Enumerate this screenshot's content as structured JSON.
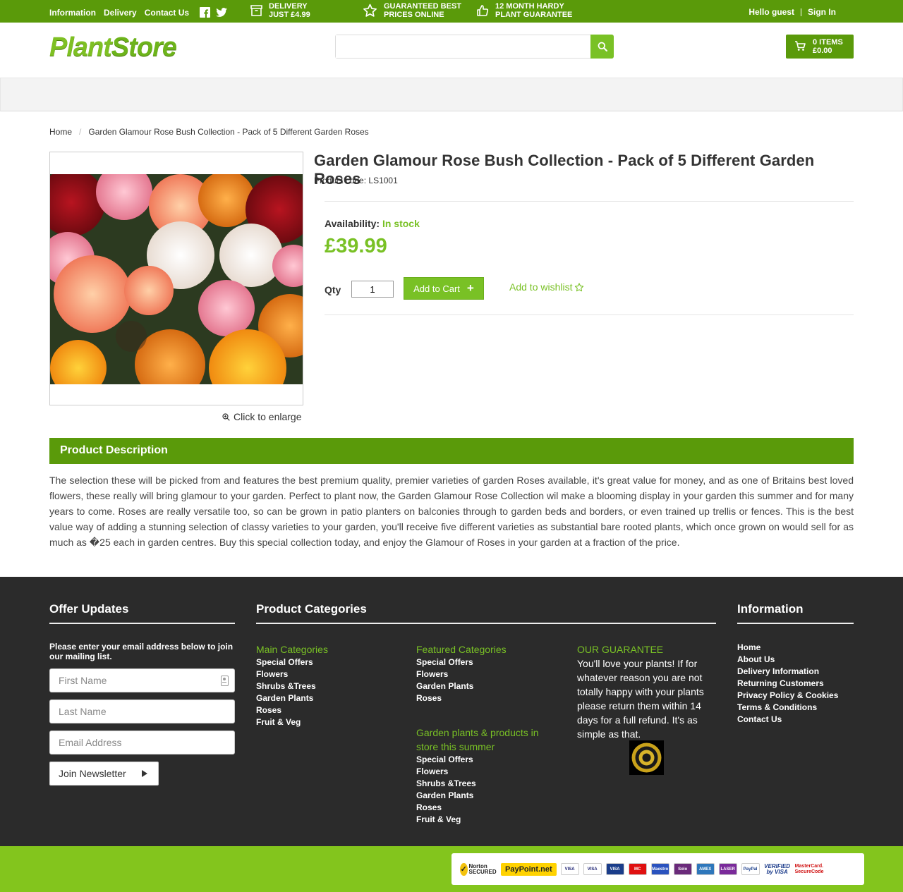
{
  "topbar": {
    "links": [
      "Information",
      "Delivery",
      "Contact Us"
    ],
    "social_icons": [
      "facebook-icon",
      "twitter-icon"
    ],
    "usps": [
      {
        "icon": "box-icon",
        "line1": "DELIVERY",
        "line2": "JUST £4.99"
      },
      {
        "icon": "star-icon",
        "line1": "GUARANTEED BEST",
        "line2": "PRICES ONLINE"
      },
      {
        "icon": "thumbs-up-icon",
        "line1": "12 MONTH HARDY",
        "line2": "PLANT GUARANTEE"
      }
    ],
    "greeting": "Hello guest",
    "signin": "Sign In"
  },
  "header": {
    "logo_part1": "Plant",
    "logo_part2": "Store",
    "search_placeholder": "",
    "cart_items": "0 ITEMS",
    "cart_total": "£0.00"
  },
  "breadcrumb": {
    "home": "Home",
    "separator": "/",
    "current": "Garden Glamour Rose Bush Collection - Pack of 5 Different Garden Roses"
  },
  "product": {
    "title": "Garden Glamour Rose Bush Collection - Pack of 5 Different Garden Roses",
    "code_label": "Product code:",
    "code": "LS1001",
    "availability_label": "Availability:",
    "availability": "In stock",
    "price": "£39.99",
    "qty_label": "Qty",
    "qty": "1",
    "add_to_cart": "Add to Cart",
    "add_to_cart_icon": "+",
    "wishlist": "Add to wishlist",
    "enlarge": "Click to enlarge"
  },
  "description": {
    "heading": "Product Description",
    "text": "The selection these will be picked from and features the best premium quality, premier varieties of garden Roses available, it's great value for money, and as one of Britains best loved flowers, these really will bring glamour to your garden. Perfect to plant now, the Garden Glamour Rose Collection wil make a blooming display in your garden this summer and for many years to come. Roses are really versatile too, so can be grown in patio planters on balconies through to garden beds and borders, or even trained up trellis or fences. This is the best value way of adding a stunning selection of classy varieties to your garden, you'll receive five different varieties as substantial bare rooted plants, which once grown on would sell for as much as �25 each in garden centres. Buy this special collection today, and enjoy the Glamour of Roses in your garden at a fraction of the price."
  },
  "footer": {
    "offer_heading": "Offer Updates",
    "offer_intro": "Please enter your email address below to join our mailing list.",
    "first_name_placeholder": "First Name",
    "last_name_placeholder": "Last Name",
    "email_placeholder": "Email Address",
    "join_button": "Join Newsletter",
    "categories_heading": "Product Categories",
    "main_categories": {
      "heading": "Main Categories",
      "items": [
        "Special Offers",
        "Flowers",
        "Shrubs &Trees",
        "Garden Plants",
        "Roses",
        "Fruit & Veg"
      ]
    },
    "featured_categories": {
      "heading": "Featured Categories",
      "items": [
        "Special Offers",
        "Flowers",
        "Garden Plants",
        "Roses"
      ]
    },
    "summer_categories": {
      "heading": "Garden plants & products in store this summer",
      "items": [
        "Special Offers",
        "Flowers",
        "Shrubs &Trees",
        "Garden Plants",
        "Roses",
        "Fruit & Veg"
      ]
    },
    "guarantee": {
      "heading": "OUR GUARANTEE",
      "text": "You'll love your plants! If for whatever reason you are not totally happy with your plants please return them within 14 days for a full refund. It's as simple as that."
    },
    "info_heading": "Information",
    "info_links": [
      "Home",
      "About Us",
      "Delivery Information",
      "Returning Customers",
      "Privacy Policy & Cookies",
      "Terms & Conditions",
      "Contact Us"
    ]
  },
  "payments": {
    "norton": "Norton SECURED",
    "paypoint": "PayPoint.net",
    "cards": [
      "VISA",
      "VISA",
      "VISA",
      "MC",
      "Maestro",
      "Solo",
      "AMEX",
      "LASER",
      "PayPal"
    ],
    "verified_by_visa": "VERIFIED by VISA",
    "mastercard_securecode": "MasterCard. SecureCode"
  },
  "colors": {
    "brand_green": "#5a9a0a",
    "accent_green": "#79c125",
    "bottom_green": "#83c51d",
    "footer_bg": "#2b2b2b"
  }
}
